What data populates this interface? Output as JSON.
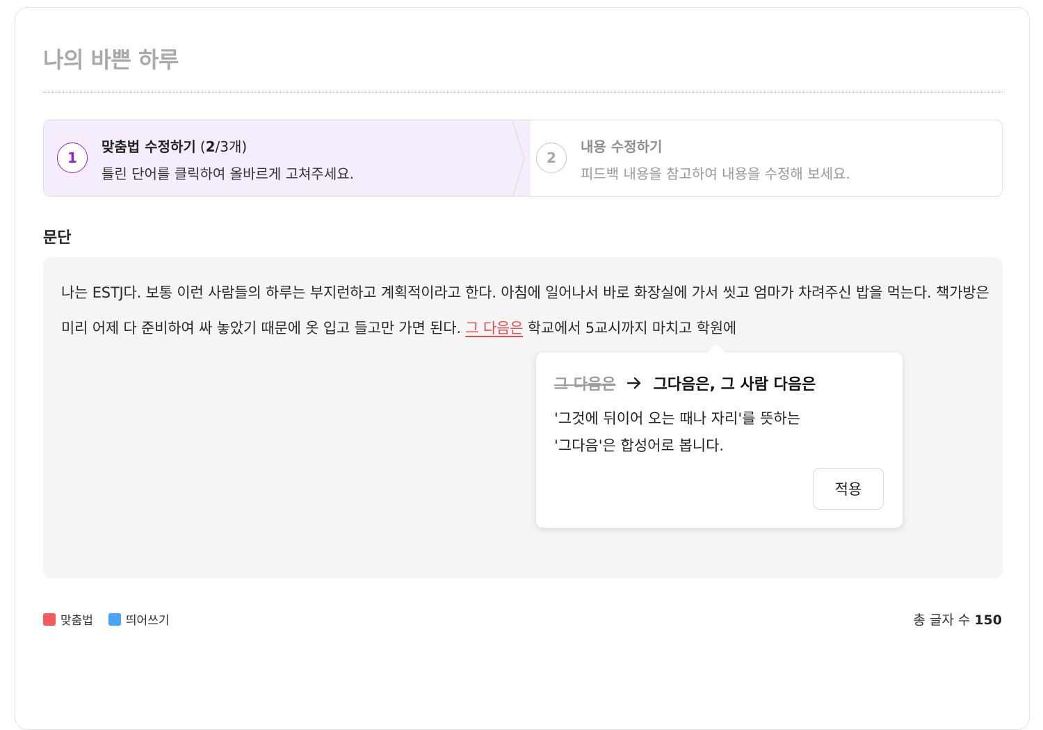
{
  "page": {
    "title": "나의 바쁜 하루"
  },
  "steps": [
    {
      "number": "1",
      "title": "맞춤법 수정하기",
      "count_open": "(",
      "count_done": "2",
      "count_rest": "/3개)",
      "description": "틀린 단어를 클릭하여 올바르게 고쳐주세요."
    },
    {
      "number": "2",
      "title": "내용 수정하기",
      "description": "피드백 내용을 참고하여 내용을 수정해 보세요."
    }
  ],
  "paragraph": {
    "label": "문단",
    "text_before": "나는 ESTJ다. 보통 이런 사람들의 하루는 부지런하고 계획적이라고 한다. 아침에 일어나서 바로 화장실에 가서 씻고 엄마가 차려주신 밥을 먹는다. 책가방은 미리 어제 다 준비하여 싸 놓았기 때문에 옷 입고 들고만 가면 된다. ",
    "error_word": "그 다음은",
    "text_after": " 학교에서 5교시까지 마치고 학원에"
  },
  "popover": {
    "wrong": "그 다음은",
    "suggestion": "그다음은, 그 사람 다음은",
    "description_line1": "'그것에 뒤이어 오는 때나 자리'를 뜻하는",
    "description_line2": "'그다음'은 합성어로 봅니다.",
    "apply_label": "적용"
  },
  "legend": [
    {
      "label": "맞춤법",
      "color": "#f55a5f"
    },
    {
      "label": "띄어쓰기",
      "color": "#4aa3f5"
    }
  ],
  "footer": {
    "total_label": "총 글자 수",
    "total_value": "150"
  },
  "colors": {
    "accent": "#8c25c4",
    "step_active_bg": "#f5edfc",
    "error": "#f04a4a"
  }
}
